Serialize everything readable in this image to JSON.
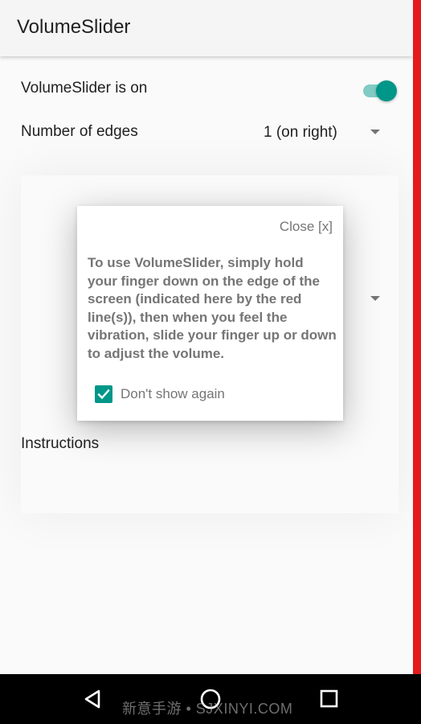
{
  "app_bar": {
    "title": "VolumeSlider"
  },
  "settings": {
    "enabled_label": "VolumeSlider is on",
    "enabled_on": true,
    "edges_label": "Number of edges",
    "edges_value": "1 (on right)",
    "instructions_label": "Instructions"
  },
  "dialog": {
    "close_label": "Close [x]",
    "body": "To use VolumeSlider, simply hold your finger down on the edge of the screen (indicated here by the red line(s)), then when you feel the vibration, slide your finger up or down to adjust the volume.",
    "checkbox_label": "Don't show again",
    "checkbox_checked": true
  },
  "nav": {
    "back_icon": "back-triangle-icon",
    "home_icon": "home-circle-icon",
    "recents_icon": "recents-square-icon"
  },
  "watermark": {
    "text": "新意手游 • SJXINYI.COM"
  },
  "colors": {
    "accent": "#009688",
    "accent_light": "#80cbc4",
    "edge_line": "#e41a1c",
    "nav_bar": "#000000"
  }
}
